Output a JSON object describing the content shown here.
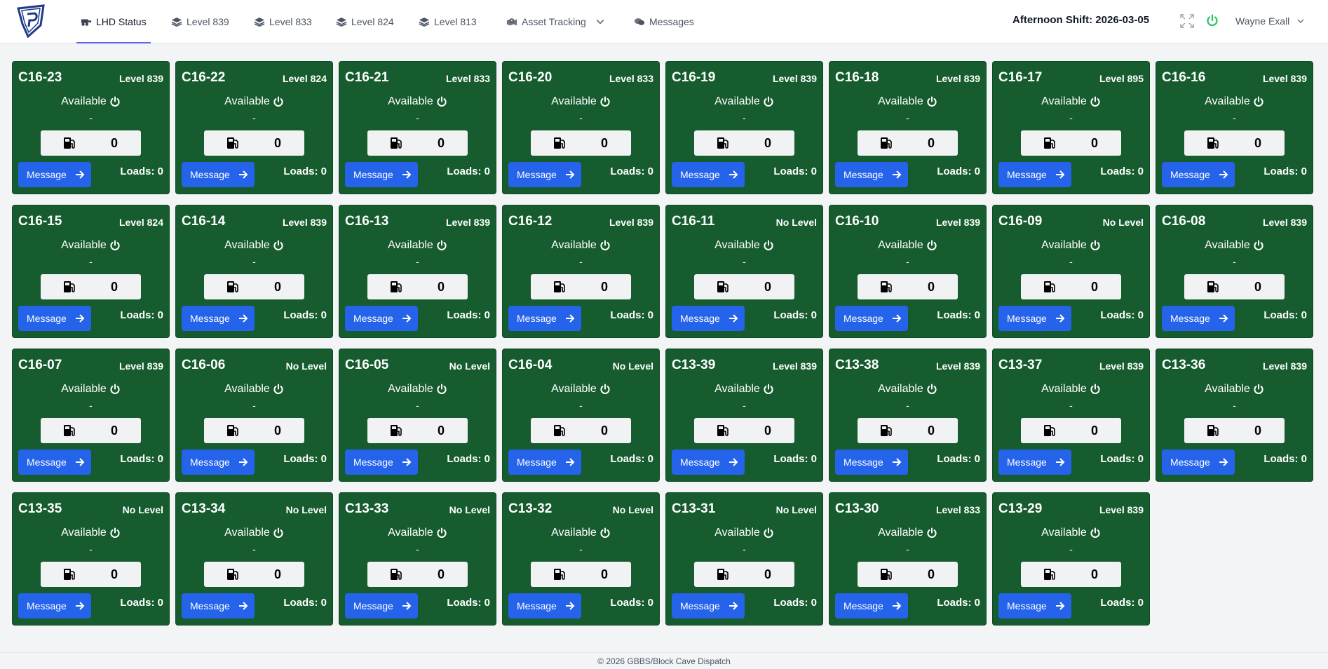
{
  "nav": {
    "tabs": [
      {
        "label": "LHD Status",
        "icon": "loader-icon",
        "active": true
      },
      {
        "label": "Level 839",
        "icon": "layers-icon"
      },
      {
        "label": "Level 833",
        "icon": "layers-icon"
      },
      {
        "label": "Level 824",
        "icon": "layers-icon"
      },
      {
        "label": "Level 813",
        "icon": "layers-icon"
      },
      {
        "label": "Asset Tracking",
        "icon": "map-pin-icon",
        "dropdown": true
      },
      {
        "label": "Messages",
        "icon": "chat-icon"
      }
    ],
    "shift": "Afternoon Shift: 2026-03-05",
    "user": "Wayne Exall"
  },
  "colors": {
    "card_bg": "#165c2f",
    "button": "#2563eb",
    "power_green": "#22c55e",
    "tab_underline": "#6366f1"
  },
  "card_labels": {
    "status": "Available",
    "dash": "-",
    "message_button": "Message",
    "loads_prefix": "Loads: "
  },
  "cards": [
    {
      "name": "C16-23",
      "level": "Level 839",
      "fuel": "0",
      "loads": "Loads: 0"
    },
    {
      "name": "C16-22",
      "level": "Level 824",
      "fuel": "0",
      "loads": "Loads: 0"
    },
    {
      "name": "C16-21",
      "level": "Level 833",
      "fuel": "0",
      "loads": "Loads: 0"
    },
    {
      "name": "C16-20",
      "level": "Level 833",
      "fuel": "0",
      "loads": "Loads: 0"
    },
    {
      "name": "C16-19",
      "level": "Level 839",
      "fuel": "0",
      "loads": "Loads: 0"
    },
    {
      "name": "C16-18",
      "level": "Level 839",
      "fuel": "0",
      "loads": "Loads: 0"
    },
    {
      "name": "C16-17",
      "level": "Level 895",
      "fuel": "0",
      "loads": "Loads: 0"
    },
    {
      "name": "C16-16",
      "level": "Level 839",
      "fuel": "0",
      "loads": "Loads: 0"
    },
    {
      "name": "C16-15",
      "level": "Level 824",
      "fuel": "0",
      "loads": "Loads: 0"
    },
    {
      "name": "C16-14",
      "level": "Level 839",
      "fuel": "0",
      "loads": "Loads: 0"
    },
    {
      "name": "C16-13",
      "level": "Level 839",
      "fuel": "0",
      "loads": "Loads: 0"
    },
    {
      "name": "C16-12",
      "level": "Level 839",
      "fuel": "0",
      "loads": "Loads: 0"
    },
    {
      "name": "C16-11",
      "level": "No Level",
      "fuel": "0",
      "loads": "Loads: 0"
    },
    {
      "name": "C16-10",
      "level": "Level 839",
      "fuel": "0",
      "loads": "Loads: 0"
    },
    {
      "name": "C16-09",
      "level": "No Level",
      "fuel": "0",
      "loads": "Loads: 0"
    },
    {
      "name": "C16-08",
      "level": "Level 839",
      "fuel": "0",
      "loads": "Loads: 0"
    },
    {
      "name": "C16-07",
      "level": "Level 839",
      "fuel": "0",
      "loads": "Loads: 0"
    },
    {
      "name": "C16-06",
      "level": "No Level",
      "fuel": "0",
      "loads": "Loads: 0"
    },
    {
      "name": "C16-05",
      "level": "No Level",
      "fuel": "0",
      "loads": "Loads: 0"
    },
    {
      "name": "C16-04",
      "level": "No Level",
      "fuel": "0",
      "loads": "Loads: 0"
    },
    {
      "name": "C13-39",
      "level": "Level 839",
      "fuel": "0",
      "loads": "Loads: 0"
    },
    {
      "name": "C13-38",
      "level": "Level 839",
      "fuel": "0",
      "loads": "Loads: 0"
    },
    {
      "name": "C13-37",
      "level": "Level 839",
      "fuel": "0",
      "loads": "Loads: 0"
    },
    {
      "name": "C13-36",
      "level": "Level 839",
      "fuel": "0",
      "loads": "Loads: 0"
    },
    {
      "name": "C13-35",
      "level": "No Level",
      "fuel": "0",
      "loads": "Loads: 0"
    },
    {
      "name": "C13-34",
      "level": "No Level",
      "fuel": "0",
      "loads": "Loads: 0"
    },
    {
      "name": "C13-33",
      "level": "No Level",
      "fuel": "0",
      "loads": "Loads: 0"
    },
    {
      "name": "C13-32",
      "level": "No Level",
      "fuel": "0",
      "loads": "Loads: 0"
    },
    {
      "name": "C13-31",
      "level": "No Level",
      "fuel": "0",
      "loads": "Loads: 0"
    },
    {
      "name": "C13-30",
      "level": "Level 833",
      "fuel": "0",
      "loads": "Loads: 0"
    },
    {
      "name": "C13-29",
      "level": "Level 839",
      "fuel": "0",
      "loads": "Loads: 0"
    }
  ],
  "footer": "© 2026 GBBS/Block Cave Dispatch"
}
